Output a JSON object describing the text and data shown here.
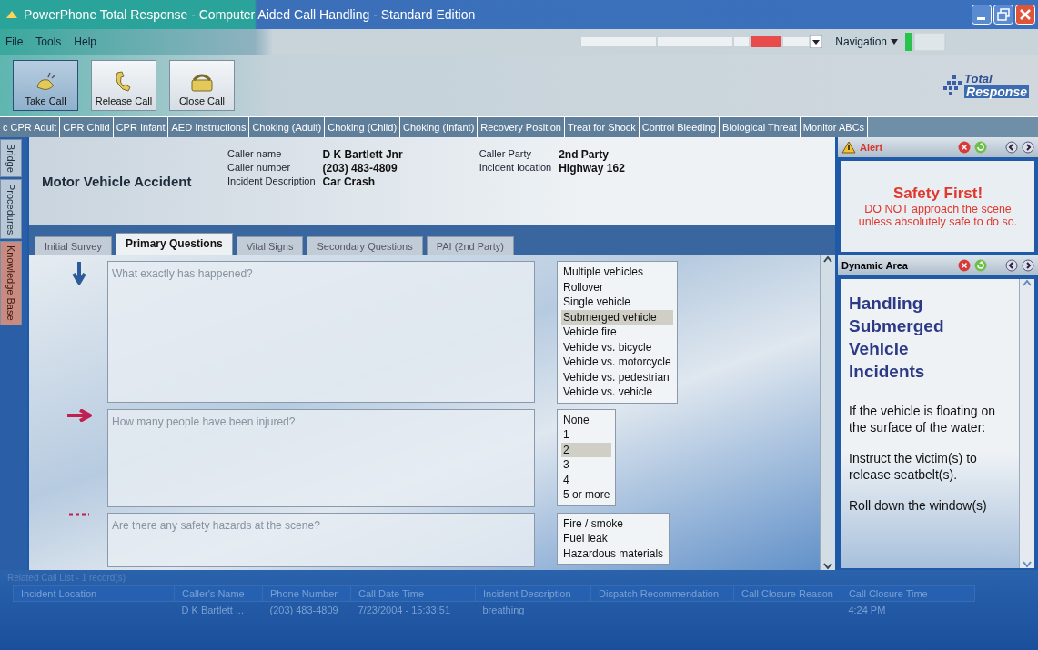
{
  "window": {
    "title": "PowerPhone Total Response - Computer Aided Call Handling - Standard Edition"
  },
  "menu": [
    "File",
    "Tools",
    "Help"
  ],
  "navigation": {
    "label": "Navigation"
  },
  "toolbar": [
    {
      "label": "Take Call",
      "selected": true
    },
    {
      "label": "Release Call",
      "selected": false
    },
    {
      "label": "Close Call",
      "selected": false
    }
  ],
  "logo": {
    "line1": "Total",
    "line2": "Response"
  },
  "protocols": [
    "c CPR Adult",
    "CPR Child",
    "CPR Infant",
    "AED Instructions",
    "Choking (Adult)",
    "Choking (Child)",
    "Choking (Infant)",
    "Recovery Position",
    "Treat for Shock",
    "Control Bleeding",
    "Biological Threat",
    "Monitor ABCs"
  ],
  "side_tabs": [
    {
      "label": "Bridge",
      "selected": false
    },
    {
      "label": "Procedures",
      "selected": false
    },
    {
      "label": "Knowledge Base",
      "selected": true
    }
  ],
  "incident": {
    "type": "Motor Vehicle Accident",
    "fields": [
      {
        "label": "Caller name",
        "value": "D K Bartlett Jnr"
      },
      {
        "label": "Caller number",
        "value": "(203) 483-4809"
      },
      {
        "label": "Incident Description",
        "value": "Car Crash"
      },
      {
        "label": "Caller Party",
        "value": "2nd Party"
      },
      {
        "label": "Incident location",
        "value": "Highway 162"
      }
    ]
  },
  "tabs": [
    {
      "label": "Initial Survey",
      "selected": false
    },
    {
      "label": "Primary Questions",
      "selected": true
    },
    {
      "label": "Vital Signs",
      "selected": false
    },
    {
      "label": "Secondary Questions",
      "selected": false
    },
    {
      "label": "PAI (2nd Party)",
      "selected": false
    }
  ],
  "questions": [
    {
      "kind": "done",
      "placeholder": "What exactly has happened?",
      "options": [
        {
          "label": "Multiple vehicles",
          "selected": false
        },
        {
          "label": "Rollover",
          "selected": false
        },
        {
          "label": "Single vehicle",
          "selected": false
        },
        {
          "label": "Submerged vehicle",
          "selected": true
        },
        {
          "label": "Vehicle fire",
          "selected": false
        },
        {
          "label": "Vehicle vs. bicycle",
          "selected": false
        },
        {
          "label": "Vehicle vs. motorcycle",
          "selected": false
        },
        {
          "label": "Vehicle vs. pedestrian",
          "selected": false
        },
        {
          "label": "Vehicle vs. vehicle",
          "selected": false
        }
      ]
    },
    {
      "kind": "current",
      "placeholder": "How many people have been injured?",
      "options": [
        {
          "label": "None",
          "selected": false
        },
        {
          "label": "1",
          "selected": false
        },
        {
          "label": "2",
          "selected": true
        },
        {
          "label": "3",
          "selected": false
        },
        {
          "label": "4",
          "selected": false
        },
        {
          "label": "5 or more",
          "selected": false
        }
      ]
    },
    {
      "kind": "pending",
      "placeholder": "Are there any safety hazards at the scene?",
      "options": [
        {
          "label": "Fire / smoke",
          "selected": false
        },
        {
          "label": "Fuel leak",
          "selected": false
        },
        {
          "label": "Hazardous materials",
          "selected": false
        }
      ]
    }
  ],
  "alert": {
    "title": "Alert",
    "heading": "Safety First!",
    "text": "DO NOT approach the scene unless absolutely safe to do so."
  },
  "dynamic_area": {
    "title": "Dynamic Area",
    "heading": "Handling Submerged Vehicle Incidents",
    "paragraphs": [
      "If the vehicle is floating on the surface of the water:",
      "Instruct the victim(s) to release seatbelt(s).",
      "Roll down the window(s)"
    ]
  },
  "call_list": {
    "title": "Related Call List - 1 record(s)",
    "columns": [
      "Incident Location",
      "Caller's Name",
      "Phone Number",
      "Call Date Time",
      "Incident Description",
      "Dispatch Recommendation",
      "Call Closure Reason",
      "Call Closure Time"
    ],
    "rows": [
      [
        "",
        "D K Bartlett ...",
        "(203) 483-4809",
        "7/23/2004 - 15:33:51",
        "breathing",
        "",
        "",
        "4:24 PM"
      ]
    ]
  }
}
